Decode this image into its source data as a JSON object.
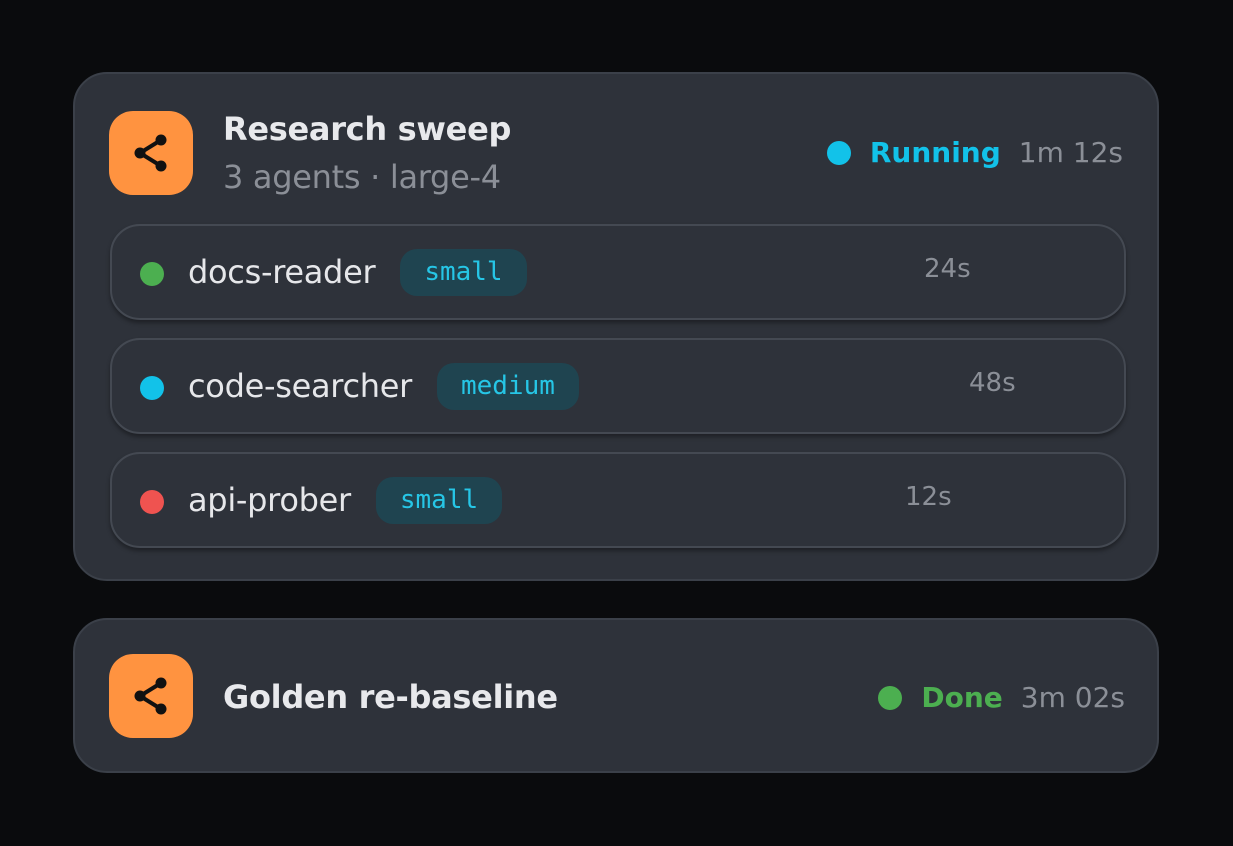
{
  "runs": [
    {
      "title": "Research sweep",
      "subtitle": "3 agents · large-4",
      "icon": "share-icon",
      "status": "Running",
      "status_color": "#12c2e9",
      "duration": "1m 12s",
      "agents": [
        {
          "name": "docs-reader",
          "model": "small",
          "time": "24s",
          "dot_color": "#4caf50"
        },
        {
          "name": "code-searcher",
          "model": "medium",
          "time": "48s",
          "dot_color": "#12c2e9"
        },
        {
          "name": "api-prober",
          "model": "small",
          "time": "12s",
          "dot_color": "#ef5350"
        }
      ]
    },
    {
      "title": "Golden re-baseline",
      "icon": "share-icon",
      "status": "Done",
      "status_color": "#4caf50",
      "duration": "3m 02s"
    }
  ],
  "colors": {
    "background": "#0a0b0d",
    "card": "#2e323a",
    "icon_accent": "#ff9340",
    "badge_bg": "#1f4450",
    "badge_text": "#26c6e6"
  }
}
